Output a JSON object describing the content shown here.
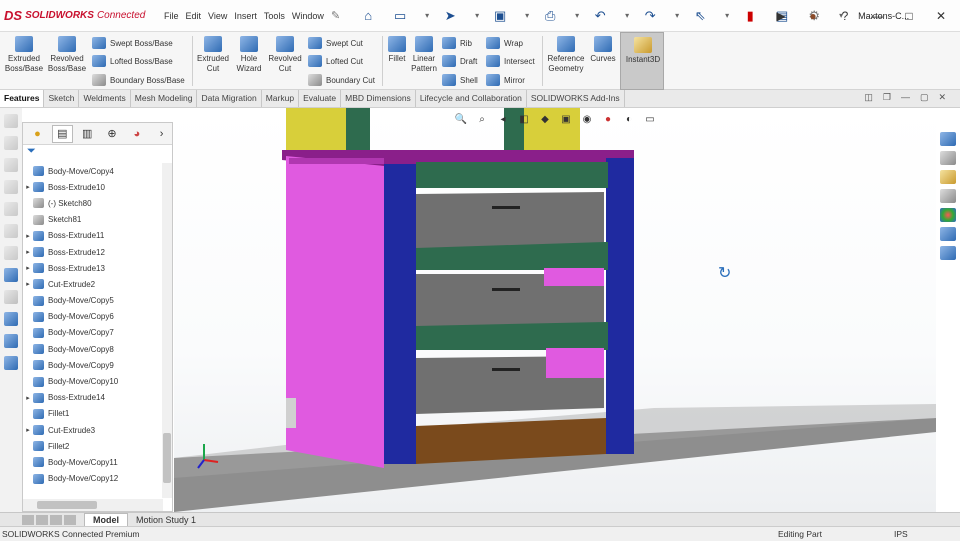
{
  "app": {
    "logo_ds": "DS",
    "logo_name": "SOLIDWORKS",
    "logo_suffix": "Connected",
    "menus": [
      "File",
      "Edit",
      "View",
      "Insert",
      "Tools",
      "Window"
    ],
    "document_name": "Maxtons-C..."
  },
  "command_manager": {
    "extruded_boss": "Extruded\nBoss/Base",
    "revolved_boss": "Revolved\nBoss/Base",
    "swept_boss": "Swept Boss/Base",
    "lofted_boss": "Lofted Boss/Base",
    "boundary_boss": "Boundary Boss/Base",
    "extruded_cut": "Extruded\nCut",
    "hole_wizard": "Hole\nWizard",
    "revolved_cut": "Revolved\nCut",
    "swept_cut": "Swept Cut",
    "lofted_cut": "Lofted Cut",
    "boundary_cut": "Boundary Cut",
    "fillet": "Fillet",
    "linear_pattern": "Linear\nPattern",
    "rib": "Rib",
    "draft": "Draft",
    "shell": "Shell",
    "wrap": "Wrap",
    "intersect": "Intersect",
    "mirror": "Mirror",
    "reference_geometry": "Reference\nGeometry",
    "curves": "Curves",
    "instant3d": "Instant3D"
  },
  "tabs": [
    "Features",
    "Sketch",
    "Weldments",
    "Mesh Modeling",
    "Data Migration",
    "Markup",
    "Evaluate",
    "MBD Dimensions",
    "Lifecycle and Collaboration",
    "SOLIDWORKS Add-Ins"
  ],
  "feature_tree": [
    {
      "label": "Body-Move/Copy4",
      "type": "body",
      "expand": false
    },
    {
      "label": "Boss-Extrude10",
      "type": "feature",
      "expand": true
    },
    {
      "label": "(-) Sketch80",
      "type": "sketch",
      "expand": false
    },
    {
      "label": "Sketch81",
      "type": "sketch",
      "expand": false
    },
    {
      "label": "Boss-Extrude11",
      "type": "feature",
      "expand": true
    },
    {
      "label": "Boss-Extrude12",
      "type": "feature",
      "expand": true
    },
    {
      "label": "Boss-Extrude13",
      "type": "feature",
      "expand": true
    },
    {
      "label": "Cut-Extrude2",
      "type": "feature",
      "expand": true
    },
    {
      "label": "Body-Move/Copy5",
      "type": "body",
      "expand": false
    },
    {
      "label": "Body-Move/Copy6",
      "type": "body",
      "expand": false
    },
    {
      "label": "Body-Move/Copy7",
      "type": "body",
      "expand": false
    },
    {
      "label": "Body-Move/Copy8",
      "type": "body",
      "expand": false
    },
    {
      "label": "Body-Move/Copy9",
      "type": "body",
      "expand": false
    },
    {
      "label": "Body-Move/Copy10",
      "type": "body",
      "expand": false
    },
    {
      "label": "Boss-Extrude14",
      "type": "feature",
      "expand": true
    },
    {
      "label": "Fillet1",
      "type": "fillet",
      "expand": false
    },
    {
      "label": "Cut-Extrude3",
      "type": "feature",
      "expand": true
    },
    {
      "label": "Fillet2",
      "type": "fillet",
      "expand": false
    },
    {
      "label": "Body-Move/Copy11",
      "type": "body",
      "expand": false
    },
    {
      "label": "Body-Move/Copy12",
      "type": "body",
      "expand": false
    }
  ],
  "model_tabs": {
    "model": "Model",
    "motion": "Motion Study 1"
  },
  "status": {
    "left": "SOLIDWORKS Connected Premium",
    "mode": "Editing Part",
    "units": "IPS"
  },
  "colors": {
    "side_panel": "#e05ae0",
    "frame": "#1f2aa0",
    "shelf_green": "#2e6b4e",
    "drawer_grey": "#777777",
    "base_brown": "#7a4a1c",
    "yellow_post": "#d8cf3a",
    "top_purple": "#8a1f8a"
  }
}
